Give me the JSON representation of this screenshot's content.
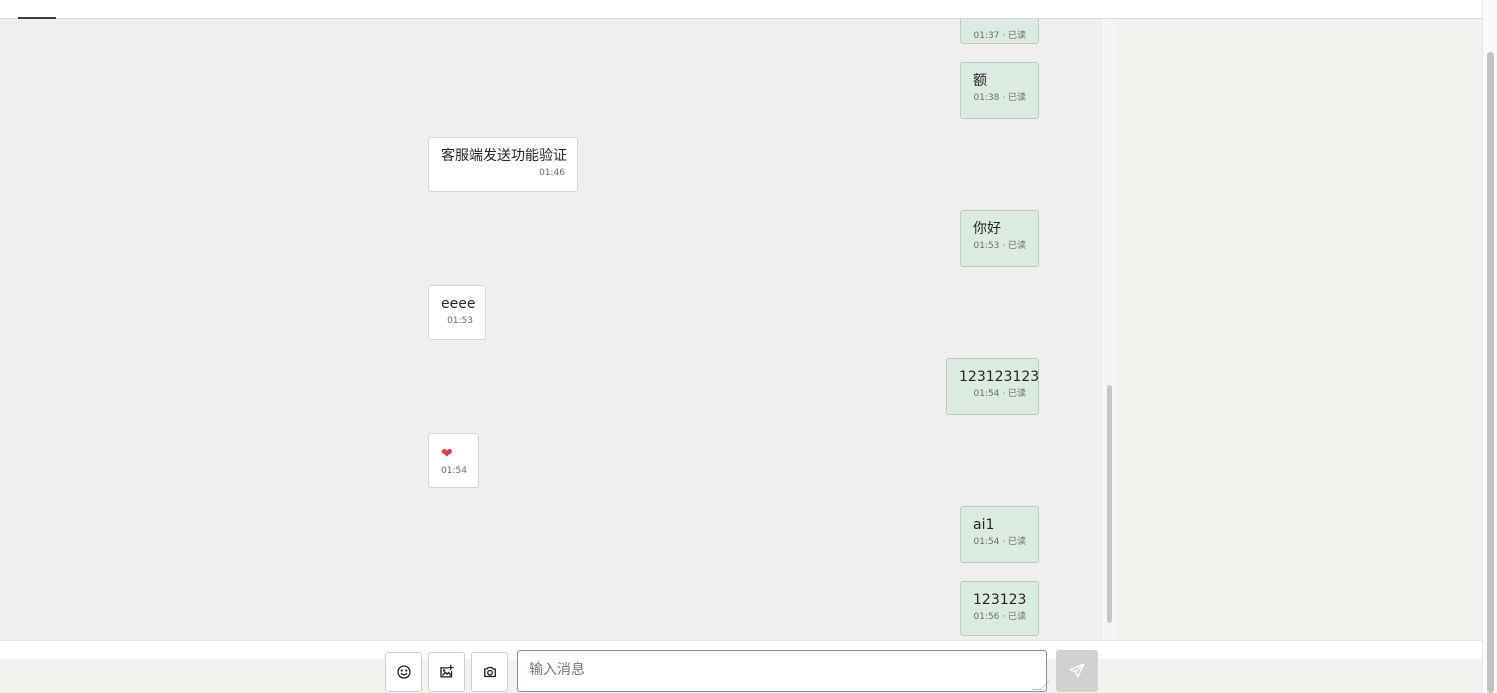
{
  "chat": {
    "messages": [
      {
        "direction": "outgoing",
        "text": "",
        "time": "01:37 · 已读"
      },
      {
        "direction": "outgoing",
        "text": "额",
        "time": "01:38 · 已读"
      },
      {
        "direction": "incoming",
        "text": "客服端发送功能验证",
        "time": "01:46"
      },
      {
        "direction": "outgoing",
        "text": "你好",
        "time": "01:53 · 已读"
      },
      {
        "direction": "incoming",
        "text": "eeee",
        "time": "01:53"
      },
      {
        "direction": "outgoing",
        "text": "123123123",
        "time": "01:54 · 已读"
      },
      {
        "direction": "incoming",
        "text": "❤",
        "time": "01:54"
      },
      {
        "direction": "outgoing",
        "text": "ai1",
        "time": "01:54 · 已读"
      },
      {
        "direction": "outgoing",
        "text": "123123",
        "time": "01:56 · 已读"
      }
    ]
  },
  "composer": {
    "placeholder": "输入消息",
    "value": "",
    "icons": {
      "emoji": "smile-icon",
      "image_upload": "image-upload-icon",
      "camera": "camera-icon",
      "send": "send-icon"
    }
  },
  "colors": {
    "chat_background": "#eff0ed",
    "outgoing_bubble": "#dcebe1",
    "incoming_bubble": "#ffffff",
    "input_border": "#77988b",
    "send_button": "#cfd2cf"
  }
}
